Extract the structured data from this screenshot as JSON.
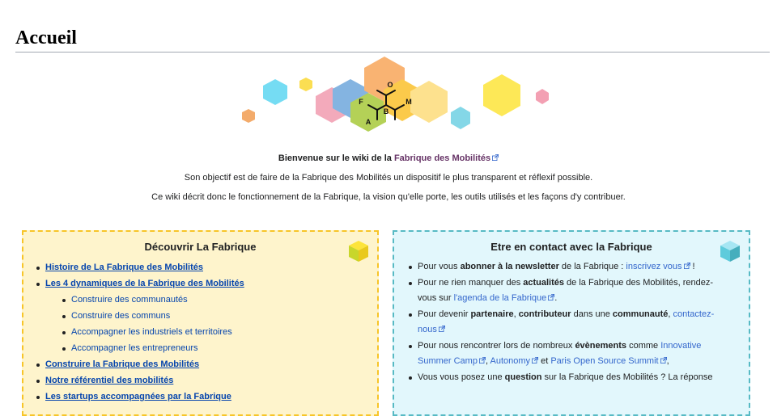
{
  "page": {
    "title": "Accueil"
  },
  "intro": {
    "welcome_prefix": "Bienvenue sur le wiki de la ",
    "welcome_link": "Fabrique des Mobilités",
    "line2": "Son objectif est de faire de la Fabrique des Mobilités un dispositif le plus transparent et réflexif possible.",
    "line3": "Ce wiki décrit donc le fonctionnement de la Fabrique, la vision qu'elle porte, les outils utilisés et les façons d'y contribuer."
  },
  "logo": {
    "letters": [
      "O",
      "F",
      "B",
      "M",
      "A"
    ]
  },
  "left_box": {
    "title": "Découvrir La Fabrique",
    "items": [
      {
        "label": "Histoire de La Fabrique des Mobilités"
      },
      {
        "label": "Les 4 dynamiques de la Fabrique des Mobilités",
        "sub": [
          "Construire des communautés",
          "Construire des communs",
          "Accompagner les industriels et territoires",
          "Accompagner les entrepreneurs"
        ]
      },
      {
        "label": "Construire la Fabrique des Mobilités"
      },
      {
        "label": "Notre référentiel des mobilités"
      },
      {
        "label": "Les startups accompagnées par la Fabrique"
      }
    ]
  },
  "right_box": {
    "title": "Etre en contact avec la Fabrique",
    "item1": {
      "t1": "Pour vous ",
      "b1": "abonner à la newsletter",
      "t2": " de la Fabrique : ",
      "link1": "inscrivez vous",
      "t3": " !"
    },
    "item2": {
      "t1": "Pour ne rien manquer des ",
      "b1": "actualités",
      "t2": " de la Fabrique des Mobilités, rendez-vous sur ",
      "link1": "l'agenda de la Fabrique",
      "t3": "."
    },
    "item3": {
      "t1": "Pour devenir ",
      "b1": "partenaire",
      "t2": ", ",
      "b2": "contributeur",
      "t3": " dans une ",
      "b3": "communauté",
      "t4": ", ",
      "link1": "contactez-nous"
    },
    "item4": {
      "t1": "Pour nous rencontrer lors de nombreux ",
      "b1": "évènements",
      "t2": " comme ",
      "link1": "Innovative Summer Camp",
      "t3": ", ",
      "link2": "Autonomy",
      "t4": " et ",
      "link3": "Paris Open Source Summit",
      "t5": ","
    },
    "item5": {
      "t1": "Vous vous posez une ",
      "b1": "question",
      "t2": " sur la Fabrique des Mobilités ? La réponse"
    }
  },
  "colors": {
    "link": "#0645ad",
    "visited": "#663366",
    "external": "#3366cc",
    "left_border": "#f7c528",
    "right_border": "#57bac4"
  }
}
